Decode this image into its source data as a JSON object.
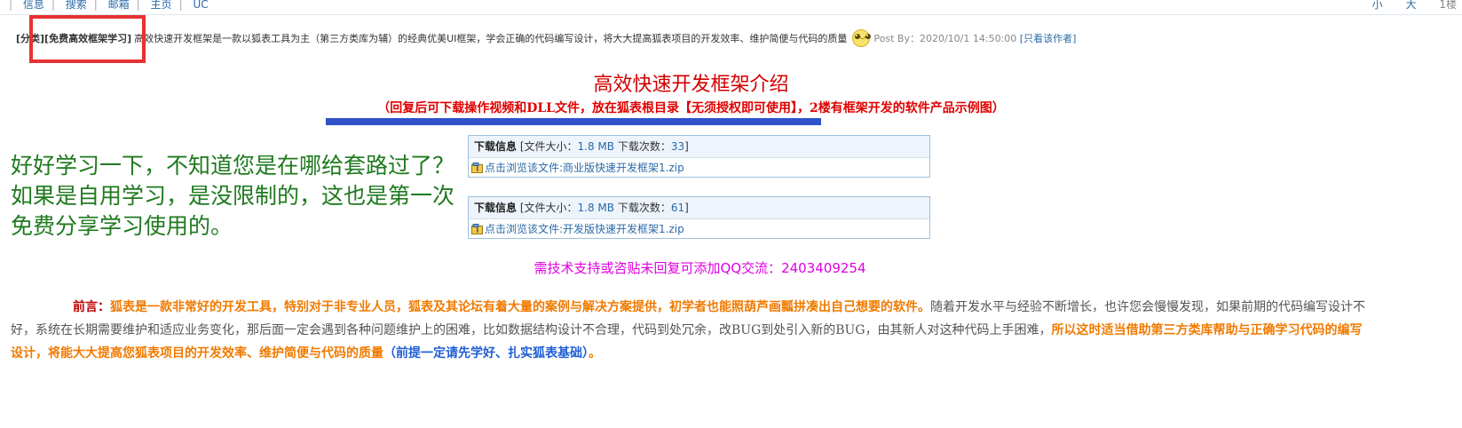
{
  "topbar": {
    "nav": [
      "信息",
      "搜索",
      "邮箱",
      "主页",
      "UC"
    ],
    "right": [
      "小",
      "大"
    ],
    "floor": "1楼"
  },
  "post": {
    "category": "[分类][免费高效框架学习]",
    "title": "高效快速开发框架是一款以狐表工具为主（第三方类库为辅）的经典优美UI框架，学会正确的代码编写设计，将大大提高狐表项目的开发效率、维护简便与代码的质量",
    "posted": "Post By：2020/10/1 14:50:00",
    "author_only": "[只看该作者]"
  },
  "content": {
    "heading": "高效快速开发框架介绍",
    "subheading": "（回复后可下载操作视频和DLL文件，放在狐表根目录【无须授权即可使用】，2楼有框架开发的软件产品示例图）",
    "handnote": "好好学习一下，不知道您是在哪给套路过了？如果是自用学习，是没限制的，这也是第一次免费分享学习使用的。",
    "support": "需技术支持或咨贴未回复可添加QQ交流：2403409254"
  },
  "downloads": [
    {
      "label": "下载信息",
      "size_prefix": "[文件大小：",
      "size": "1.8 MB",
      "count_prefix": "下载次数：",
      "count": "33",
      "suffix": "]",
      "link": "点击浏览该文件:商业版快速开发框架1.zip"
    },
    {
      "label": "下载信息",
      "size_prefix": "[文件大小：",
      "size": "1.8 MB",
      "count_prefix": "下载次数：",
      "count": "61",
      "suffix": "]",
      "link": "点击浏览该文件:开发版快速开发框架1.zip"
    }
  ],
  "preface": {
    "lead": "前言：",
    "bold1": "狐表是一款非常好的开发工具，特别对于非专业人员，狐表及其论坛有着大量的案例与解决方案提供，初学者也能照葫芦画瓢拼凑出自己想要的软件。",
    "normal": "随着开发水平与经验不断增长，也许您会慢慢发现，如果前期的代码编写设计不好，系统在长期需要维护和适应业务变化，那后面一定会遇到各种问题维护上的困难，比如数据结构设计不合理，代码到处冗余，改BUG到处引入新的BUG，由其新人对这种代码上手困难，",
    "bold2": "所以这时适当借助第三方类库帮助与正确学习代码的编写设计，将能大大提高您狐表项目的开发效率、维护简便与代码的质量",
    "blue": "（前提一定请先学好、扎实狐表基础）",
    "end": "。"
  },
  "colors": {
    "heading": "#d20000",
    "handnote": "#1f7a1f",
    "support": "#e000e0",
    "link": "#2b6aa8",
    "highlight_box": "#e63232",
    "underline": "#2f52c8"
  }
}
